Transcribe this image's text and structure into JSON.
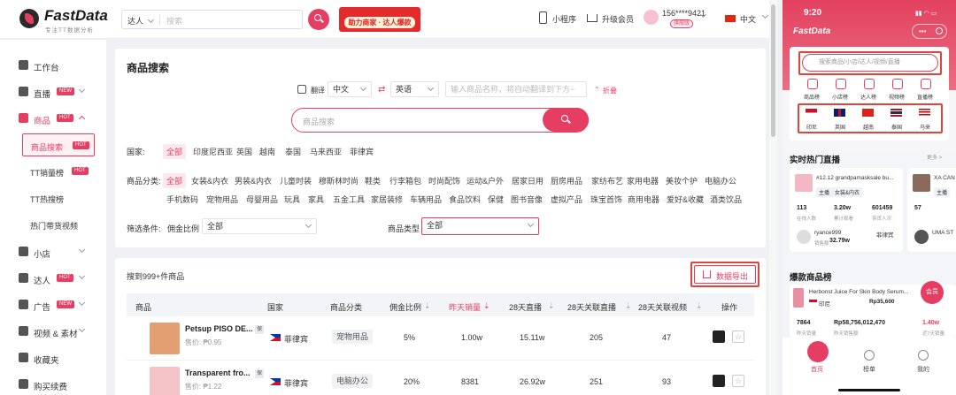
{
  "header": {
    "brand": "FastData",
    "brand_sub": "专注TT数据分析",
    "search_scope": "达人",
    "search_placeholder": "搜索",
    "banner_top": "",
    "banner_text": "助力商家 · 达人爆款",
    "mini_program": "小程序",
    "upgrade": "升级会员",
    "user_id": "156****9421",
    "vip": "旗舰版",
    "language": "中文"
  },
  "sidebar": {
    "items": [
      {
        "label": "工作台",
        "badge": ""
      },
      {
        "label": "直播",
        "badge": "NEW"
      },
      {
        "label": "商品",
        "badge": "HOT"
      },
      {
        "label": "小店",
        "badge": ""
      },
      {
        "label": "达人",
        "badge": "HOT"
      },
      {
        "label": "广告",
        "badge": "NEW"
      },
      {
        "label": "视频 & 素材",
        "badge": ""
      },
      {
        "label": "收藏夹",
        "badge": ""
      },
      {
        "label": "购买续费",
        "badge": ""
      }
    ],
    "sub_items": [
      {
        "label": "商品搜索",
        "badge": "HOT"
      },
      {
        "label": "TT销量榜",
        "badge": "HOT"
      },
      {
        "label": "TT热搜榜",
        "badge": ""
      },
      {
        "label": "热门带货视频",
        "badge": ""
      }
    ]
  },
  "search_panel": {
    "title": "商品搜索",
    "translate_label": "翻译",
    "from_lang": "中文",
    "to_lang": "英语",
    "translate_placeholder": "输入商品名称，将自动翻译到下方~",
    "collapse": "折叠",
    "main_placeholder": "商品搜索",
    "country_label": "国家:",
    "countries": [
      "全部",
      "印度尼西亚",
      "英国",
      "越南",
      "泰国",
      "马来西亚",
      "菲律宾"
    ],
    "category_label": "商品分类:",
    "categories_row1": [
      "全部",
      "女装&内衣",
      "男装&内衣",
      "儿童时装",
      "穆斯林时尚",
      "鞋类",
      "行李箱包",
      "时尚配饰",
      "运动&户外",
      "居家日用",
      "厨房用品",
      "家纺布艺",
      "家用电器",
      "美妆个护",
      "电脑办公"
    ],
    "categories_row2": [
      "手机数码",
      "宠物用品",
      "母婴用品",
      "玩具",
      "家具",
      "五金工具",
      "家居装修",
      "车辆用品",
      "食品饮料",
      "保健",
      "图书音像",
      "虚拟产品",
      "珠宝首饰",
      "商用电器",
      "爱好&收藏",
      "酒类饮品"
    ],
    "filter_label": "筛选条件:",
    "commission_label": "佣金比例",
    "commission_value": "全部",
    "type_label": "商品类型",
    "type_value": "全部"
  },
  "results": {
    "found": "搜到999+件商品",
    "export": "数据导出",
    "columns": [
      "商品",
      "国家",
      "商品分类",
      "佣金比例",
      "昨天销量",
      "28天直播",
      "28天关联直播",
      "28天关联视频",
      "操作"
    ],
    "rows": [
      {
        "name": "Petsup PISO DE...",
        "tag": "保",
        "price": "售价: ₱0.95",
        "country": "菲律宾",
        "category": "宠物用品",
        "commission": "5%",
        "sales": "1.00w",
        "live28": "15.11w",
        "rel_live": "205",
        "rel_video": "47"
      },
      {
        "name": "Transparent fro...",
        "tag": "保",
        "price": "售价: ₱1.22",
        "country": "菲律宾",
        "category": "电脑办公",
        "commission": "20%",
        "sales": "8381",
        "live28": "26.92w",
        "rel_live": "251",
        "rel_video": "93"
      }
    ]
  },
  "phone": {
    "time": "9:20",
    "brand": "FastData",
    "search_placeholder": "搜索商品/小店/达人/视频/直播",
    "icons": [
      "商品榜",
      "小店榜",
      "达人榜",
      "视频榜",
      "直播榜"
    ],
    "flags": [
      "印尼",
      "英国",
      "越南",
      "泰国",
      "马来"
    ],
    "live_title": "实时热门直播",
    "more": "更多 >",
    "live_card": {
      "title": "#12.12 grandpamasksale bu...",
      "tag1": "主播",
      "tag2": "女装&内衣",
      "n1": "113",
      "n2": "3.20w",
      "n3": "601459",
      "l1": "在线人数",
      "l2": "累计观看",
      "l3": "带货人次",
      "host": "ryance999",
      "country": "菲律宾",
      "sales_label": "销售额",
      "sales": "32.79w"
    },
    "live_card2": {
      "title": "XA CAN",
      "tag1": "主播",
      "n1": "57",
      "host": "UMA ST"
    },
    "hot_title": "爆款商品榜",
    "product": {
      "name": "Herbonst Juice For Skin Body Serum...",
      "country": "印尼",
      "price": "Rp35,600",
      "n1": "7864",
      "n2": "Rp58,756,012,470",
      "n3": "1.40w",
      "l1": "昨天销量",
      "l2": "昨天销售额",
      "l3": "近7天销量"
    },
    "float_btn": "会员",
    "tabs": [
      "首页",
      "榜单",
      "我的"
    ]
  }
}
